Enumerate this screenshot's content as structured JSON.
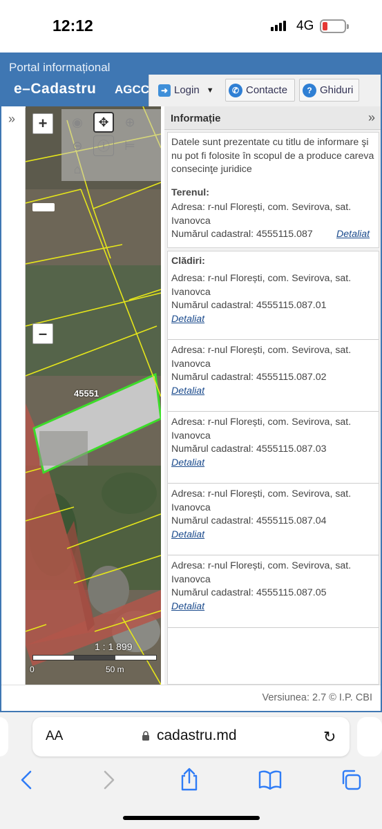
{
  "status": {
    "time": "12:12",
    "network": "4G"
  },
  "header": {
    "portal": "Portal informațional",
    "brand": "e–Cadastru",
    "agency": "AGCC",
    "login_label": "Login",
    "contacts_label": "Contacte",
    "guides_label": "Ghiduri"
  },
  "map": {
    "zoom_in": "+",
    "zoom_out": "–",
    "parcel_label": "45551",
    "scale_ratio": "1 : 1 899",
    "scale_zero": "0",
    "scale_distance": "50 m"
  },
  "info": {
    "title": "Informație",
    "collapse_icon": "»",
    "disclaimer": "Datele sunt prezentate cu titlu de informare şi nu pot fi folosite în scopul de a produce careva consecinţe juridice",
    "land_title": "Terenul:",
    "land_address": "Adresa: r-nul Florești, com. Sevirova, sat. Ivanovca",
    "land_cadastral": "Numărul cadastral: 4555115.087",
    "details_label": "Detaliat",
    "buildings_title": "Clădiri:",
    "buildings": [
      {
        "address": "Adresa: r-nul Florești, com. Sevirova, sat. Ivanovca",
        "cadastral": "Numărul cadastral: 4555115.087.01",
        "link": "Detaliat"
      },
      {
        "address": "Adresa: r-nul Florești, com. Sevirova, sat. Ivanovca",
        "cadastral": "Numărul cadastral: 4555115.087.02",
        "link": "Detaliat"
      },
      {
        "address": "Adresa: r-nul Florești, com. Sevirova, sat. Ivanovca",
        "cadastral": "Numărul cadastral: 4555115.087.03",
        "link": "Detaliat"
      },
      {
        "address": "Adresa: r-nul Florești, com. Sevirova, sat. Ivanovca",
        "cadastral": "Numărul cadastral: 4555115.087.04",
        "link": "Detaliat"
      },
      {
        "address": "Adresa: r-nul Florești, com. Sevirova, sat. Ivanovca",
        "cadastral": "Numărul cadastral: 4555115.087.05",
        "link": "Detaliat"
      }
    ]
  },
  "footer": {
    "version": "Versiunea: 2.7 © I.P. CBI"
  },
  "browser": {
    "text_size": "AA",
    "url": "cadastru.md"
  },
  "icons": [
    "login-icon",
    "phone-icon",
    "help-icon",
    "pan-icon",
    "zoom-icon",
    "home-icon",
    "lock-icon",
    "reload-icon",
    "back-icon",
    "forward-icon",
    "share-icon",
    "bookmarks-icon",
    "tabs-icon"
  ],
  "colors": {
    "header_blue": "#3f77b3",
    "parcel_green": "#3ddc2a",
    "boundary_yellow": "#e6e61a",
    "road_red": "#b2564a",
    "link_blue": "#1a4a8c"
  }
}
